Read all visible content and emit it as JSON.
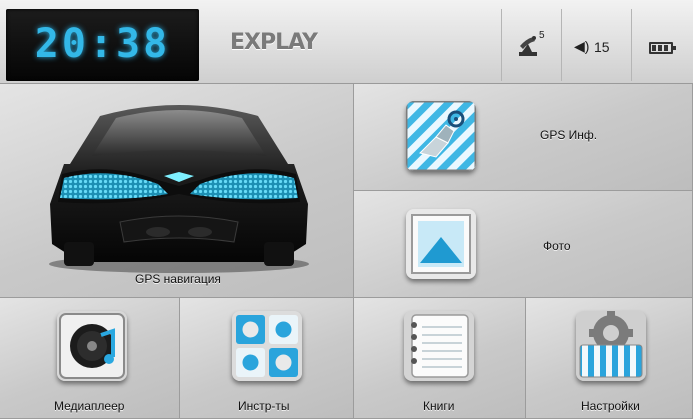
{
  "status_bar": {
    "clock": "20:38",
    "brand": "EXPLAY",
    "satellites": "5",
    "volume": "15",
    "icons": [
      "satellite-icon",
      "speaker-icon",
      "battery-icon"
    ]
  },
  "tiles": {
    "nav": {
      "label": "GPS навигация",
      "icon": "car-icon"
    },
    "gps_info": {
      "label": "GPS  Инф.",
      "icon": "gps-info-icon"
    },
    "photo": {
      "label": "Фото",
      "icon": "photo-icon"
    },
    "media": {
      "label": "Медиаплеер",
      "icon": "media-player-icon"
    },
    "tools": {
      "label": "Инстр-ты",
      "icon": "tools-icon"
    },
    "books": {
      "label": "Книги",
      "icon": "notebook-icon"
    },
    "settings": {
      "label": "Настройки",
      "icon": "settings-icon"
    }
  },
  "colors": {
    "accent": "#33b8e8",
    "panel": "#d0d0d0",
    "clock_bg": "#0a0a0a"
  }
}
